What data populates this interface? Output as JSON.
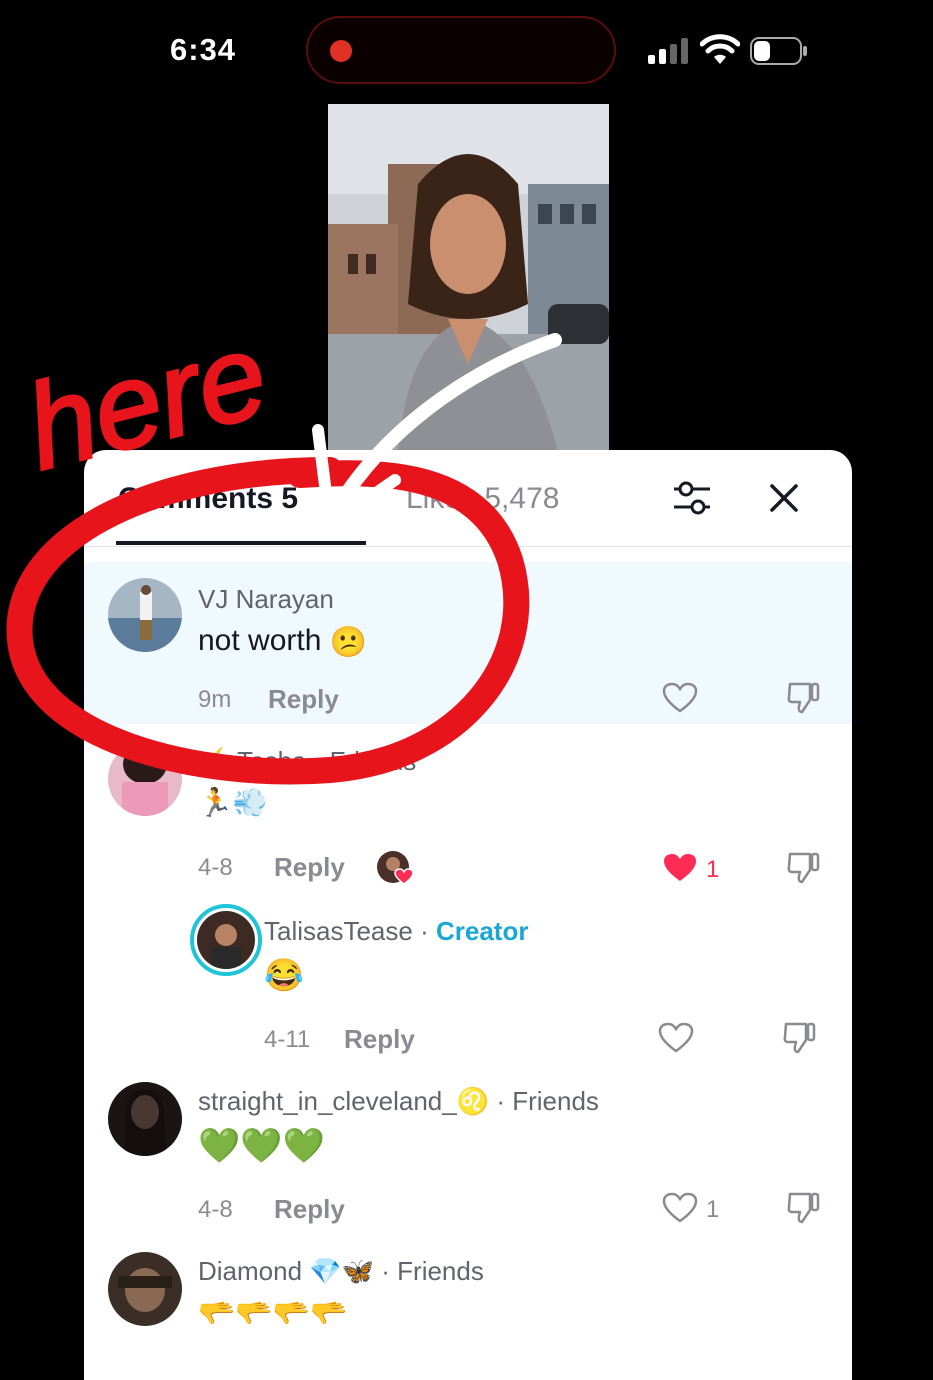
{
  "status": {
    "time": "6:34"
  },
  "annotation": {
    "text": "here"
  },
  "tabs": {
    "comments": "Comments 5",
    "likes": "Likes 5,478"
  },
  "comments": [
    {
      "user": "VJ Narayan",
      "text": "not worth",
      "emoji": "😕",
      "time": "9m",
      "reply": "Reply"
    },
    {
      "user": "⚡ Tasha · Friends",
      "emoji": "🏃💨",
      "time": "4-8",
      "reply": "Reply",
      "likes": "1",
      "liked": true
    },
    {
      "user": "TalisasTease",
      "creator_badge": "Creator",
      "emoji": "😂",
      "time": "4-11",
      "reply": "Reply"
    },
    {
      "user": "straight_in_cleveland_♌",
      "tag": "· Friends",
      "emoji": "💚💚💚",
      "time": "4-8",
      "reply": "Reply",
      "likes": "1"
    },
    {
      "user": "Diamond 💎🦋",
      "tag": "· Friends",
      "emoji": "🫳🫳🫳🫳"
    }
  ],
  "colors": {
    "accent_red": "#fe2c55",
    "creator_blue": "#1ba7d4",
    "highlight_bg": "#f0f9fd",
    "marker_red": "#e8141b"
  }
}
